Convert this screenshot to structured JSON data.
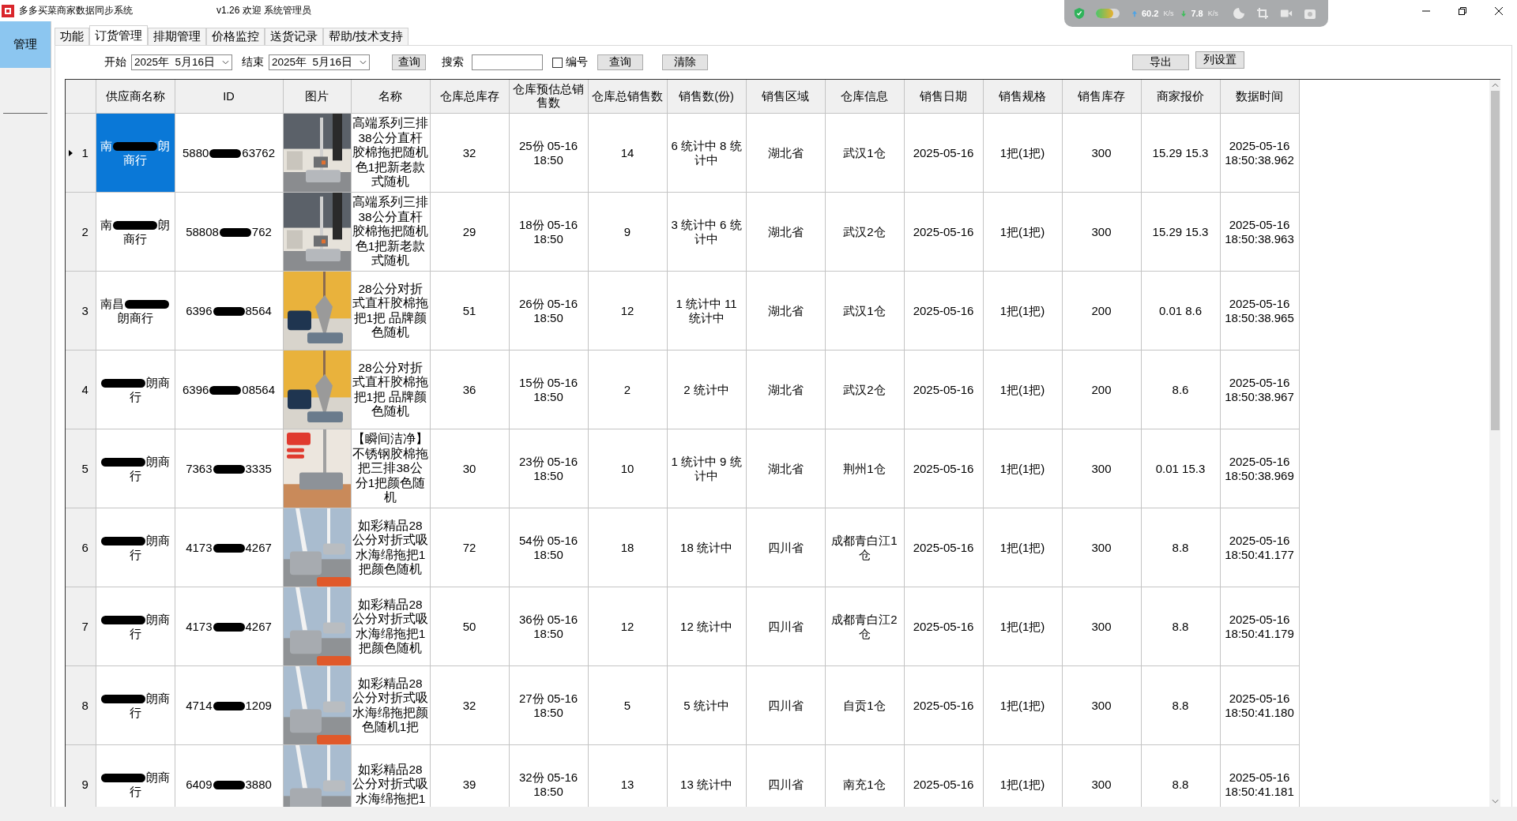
{
  "window": {
    "title": "多多买菜商家数据同步系统",
    "subtitle": "v1.26  欢迎 系统管理员"
  },
  "net_monitor": {
    "upload": "60.2",
    "upload_unit": "K/s",
    "download": "7.8",
    "download_unit": "K/s"
  },
  "sidebar": {
    "items": [
      {
        "label": "管理",
        "selected": true
      }
    ]
  },
  "tabs": [
    {
      "label": "功能",
      "selected": false
    },
    {
      "label": "订货管理",
      "selected": true
    },
    {
      "label": "排期管理",
      "selected": false
    },
    {
      "label": "价格监控",
      "selected": false
    },
    {
      "label": "送货记录",
      "selected": false
    },
    {
      "label": "帮助/技术支持",
      "selected": false
    }
  ],
  "toolbar": {
    "start_label": "开始",
    "start_date": "2025年  5月16日",
    "end_label": "结束",
    "end_date": "2025年  5月16日",
    "query_button": "查询",
    "search_label": "搜索",
    "number_checkbox": {
      "label": "编号",
      "checked": false
    },
    "search_button": "查询",
    "clear_button": "清除",
    "export_button": "导出",
    "columns_button": "列设置"
  },
  "table": {
    "columns": [
      "供应商名称",
      "ID",
      "图片",
      "名称",
      "仓库总库存",
      "仓库预估总销售数",
      "仓库总销售数",
      "销售数(份)",
      "销售区域",
      "仓库信息",
      "销售日期",
      "销售规格",
      "销售库存",
      "商家报价",
      "数据时间"
    ],
    "rows": [
      {
        "number": "1",
        "selected": true,
        "supplier_start": "南",
        "supplier_end": "朗商行",
        "id_start": "5880",
        "id_end": "63762",
        "name": "高端系列三排38公分直杆胶棉拖把随机色1把新老款式随机",
        "stock": "32",
        "estimated_sales": "25份 05-16 18:50",
        "total_sales": "14",
        "sales_count": "6 统计中 8 统计中",
        "region": "湖北省",
        "warehouse": "武汉1仓",
        "sale_date": "2025-05-16",
        "spec": "1把(1把)",
        "sale_stock": "300",
        "price": "15.29 15.3",
        "data_time": "2025-05-16 18:50:38.962"
      },
      {
        "number": "2",
        "selected": false,
        "supplier_start": "南",
        "supplier_end": "朗商行",
        "id_start": "58808",
        "id_end": "762",
        "name": "高端系列三排38公分直杆胶棉拖把随机色1把新老款式随机",
        "stock": "29",
        "estimated_sales": "18份 05-16 18:50",
        "total_sales": "9",
        "sales_count": "3 统计中 6 统计中",
        "region": "湖北省",
        "warehouse": "武汉2仓",
        "sale_date": "2025-05-16",
        "spec": "1把(1把)",
        "sale_stock": "300",
        "price": "15.29 15.3",
        "data_time": "2025-05-16 18:50:38.963"
      },
      {
        "number": "3",
        "selected": false,
        "supplier_start": "南昌",
        "supplier_end": "朗商行",
        "id_start": "6396",
        "id_end": "8564",
        "name": "28公分对折式直杆胶棉拖把1把 品牌颜色随机",
        "stock": "51",
        "estimated_sales": "26份 05-16 18:50",
        "total_sales": "12",
        "sales_count": "1 统计中 11 统计中",
        "region": "湖北省",
        "warehouse": "武汉1仓",
        "sale_date": "2025-05-16",
        "spec": "1把(1把)",
        "sale_stock": "200",
        "price": "0.01 8.6",
        "data_time": "2025-05-16 18:50:38.965"
      },
      {
        "number": "4",
        "selected": false,
        "supplier_end": "朗商行",
        "id_start": "6396",
        "id_end": "08564",
        "name": "28公分对折式直杆胶棉拖把1把 品牌颜色随机",
        "stock": "36",
        "estimated_sales": "15份 05-16 18:50",
        "total_sales": "2",
        "sales_count": "2 统计中",
        "region": "湖北省",
        "warehouse": "武汉2仓",
        "sale_date": "2025-05-16",
        "spec": "1把(1把)",
        "sale_stock": "200",
        "price": "8.6",
        "data_time": "2025-05-16 18:50:38.967"
      },
      {
        "number": "5",
        "selected": false,
        "supplier_end": "朗商行",
        "id_start": "7363",
        "id_end": "3335",
        "name": "【瞬间洁净】不锈钢胶棉拖把三排38公分1把颜色随机",
        "stock": "30",
        "estimated_sales": "23份 05-16 18:50",
        "total_sales": "10",
        "sales_count": "1 统计中 9 统计中",
        "region": "湖北省",
        "warehouse": "荆州1仓",
        "sale_date": "2025-05-16",
        "spec": "1把(1把)",
        "sale_stock": "300",
        "price": "0.01 15.3",
        "data_time": "2025-05-16 18:50:38.969"
      },
      {
        "number": "6",
        "selected": false,
        "supplier_end": "朗商行",
        "id_start": "4173",
        "id_end": "4267",
        "name": "如彩精品28公分对折式吸水海绵拖把1把颜色随机",
        "stock": "72",
        "estimated_sales": "54份 05-16 18:50",
        "total_sales": "18",
        "sales_count": "18 统计中",
        "region": "四川省",
        "warehouse": "成都青白江1仓",
        "sale_date": "2025-05-16",
        "spec": "1把(1把)",
        "sale_stock": "300",
        "price": "8.8",
        "data_time": "2025-05-16 18:50:41.177"
      },
      {
        "number": "7",
        "selected": false,
        "supplier_end": "朗商行",
        "id_start": "4173",
        "id_end": "4267",
        "name": "如彩精品28公分对折式吸水海绵拖把1把颜色随机",
        "stock": "50",
        "estimated_sales": "36份 05-16 18:50",
        "total_sales": "12",
        "sales_count": "12 统计中",
        "region": "四川省",
        "warehouse": "成都青白江2仓",
        "sale_date": "2025-05-16",
        "spec": "1把(1把)",
        "sale_stock": "300",
        "price": "8.8",
        "data_time": "2025-05-16 18:50:41.179"
      },
      {
        "number": "8",
        "selected": false,
        "supplier_end": "朗商行",
        "id_start": "4714",
        "id_end": "1209",
        "name": "如彩精品28公分对折式吸水海绵拖把颜色随机1把",
        "stock": "32",
        "estimated_sales": "27份 05-16 18:50",
        "total_sales": "5",
        "sales_count": "5 统计中",
        "region": "四川省",
        "warehouse": "自贡1仓",
        "sale_date": "2025-05-16",
        "spec": "1把(1把)",
        "sale_stock": "300",
        "price": "8.8",
        "data_time": "2025-05-16 18:50:41.180"
      },
      {
        "number": "9",
        "selected": false,
        "supplier_end": "朗商行",
        "id_start": "6409",
        "id_end": "3880",
        "name": "如彩精品28公分对折式吸水海绵拖把1",
        "stock": "39",
        "estimated_sales": "32份 05-16 18:50",
        "total_sales": "13",
        "sales_count": "13 统计中",
        "region": "四川省",
        "warehouse": "南充1仓",
        "sale_date": "2025-05-16",
        "spec": "1把(1把)",
        "sale_stock": "300",
        "price": "8.8",
        "data_time": "2025-05-16 18:50:41.181"
      }
    ]
  }
}
